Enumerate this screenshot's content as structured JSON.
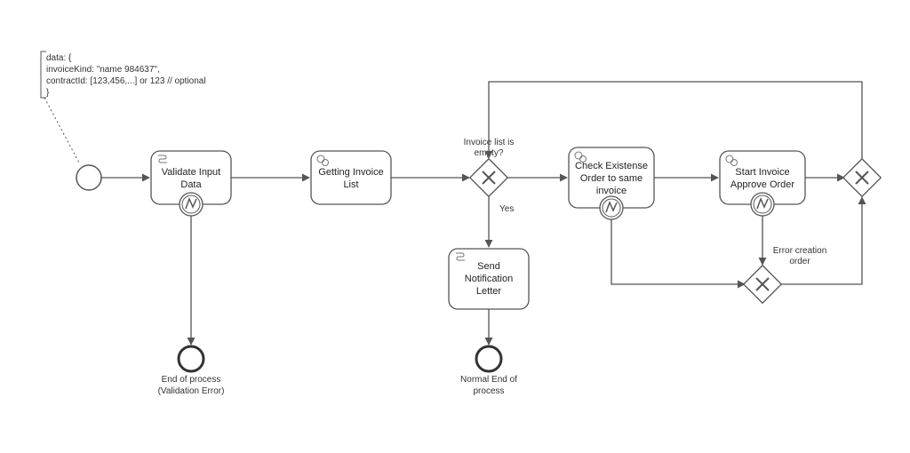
{
  "annotation": {
    "line1": "data: {",
    "line2": "  invoiceKind: \"name 984637\",",
    "line3": "  contractId: [123,456,...] or 123  // optional",
    "line4": "}"
  },
  "tasks": {
    "validate": {
      "title1": "Validate Input",
      "title2": "Data"
    },
    "getList": {
      "title1": "Getting Invoice",
      "title2": "List"
    },
    "checkExist": {
      "title1": "Check Existense",
      "title2": "Order to same",
      "title3": "invoice"
    },
    "startApprove": {
      "title1": "Start Invoice",
      "title2": "Approve Order"
    },
    "sendLetter": {
      "title1": "Send",
      "title2": "Notification",
      "title3": "Letter"
    }
  },
  "gateways": {
    "g1_label1": "Invoice list is",
    "g1_label2": "empty?",
    "g1_yes": "Yes",
    "g3_label1": "Error creation",
    "g3_label2": "order"
  },
  "endEvents": {
    "validationError1": "End of process",
    "validationError2": "(Validation Error)",
    "normal1": "Normal End of",
    "normal2": "process"
  }
}
